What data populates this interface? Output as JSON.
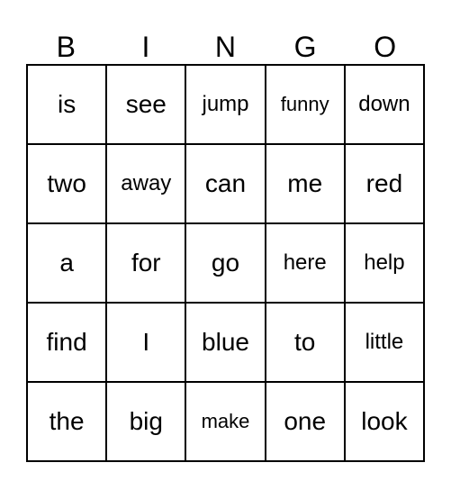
{
  "card": {
    "headers": [
      "B",
      "I",
      "N",
      "G",
      "O"
    ],
    "rows": [
      [
        "is",
        "see",
        "jump",
        "funny",
        "down"
      ],
      [
        "two",
        "away",
        "can",
        "me",
        "red"
      ],
      [
        "a",
        "for",
        "go",
        "here",
        "help"
      ],
      [
        "find",
        "I",
        "blue",
        "to",
        "little"
      ],
      [
        "the",
        "big",
        "make",
        "one",
        "look"
      ]
    ]
  },
  "style": {
    "border_color": "#000000",
    "text_color": "#000000",
    "background_color": "#ffffff"
  }
}
